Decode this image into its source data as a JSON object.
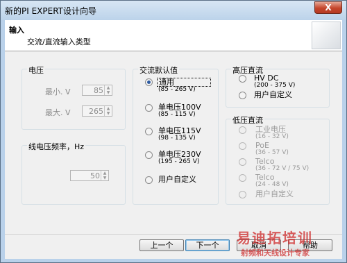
{
  "window": {
    "title": "新的PI EXPERT设计向导",
    "close_glyph": "X"
  },
  "header": {
    "title": "输入",
    "subtitle": "交流/直流输入类型"
  },
  "voltage": {
    "label": "电压",
    "min_label": "最小. V",
    "min_value": "85",
    "max_label": "最大. V",
    "max_value": "265"
  },
  "frequency": {
    "label": "线电压频率，Hz",
    "value": "50"
  },
  "ac_default": {
    "label": "交流默认值",
    "options": [
      {
        "label": "通用",
        "range": "(85 - 265 V)",
        "checked": true
      },
      {
        "label": "单电压100V",
        "range": "(85 - 115 V)",
        "checked": false
      },
      {
        "label": "单电压115V",
        "range": "(98 - 135 V)",
        "checked": false
      },
      {
        "label": "单电压230V",
        "range": "(195 - 265 V)",
        "checked": false
      },
      {
        "label": "用户自定义",
        "range": "",
        "checked": false
      }
    ]
  },
  "hv_dc": {
    "label": "高压直流",
    "options": [
      {
        "label": "HV DC",
        "range": "(200 - 375 V)"
      },
      {
        "label": "用户自定义",
        "range": ""
      }
    ]
  },
  "lv_dc": {
    "label": "低压直流",
    "options": [
      {
        "label": "工业电压",
        "range": "(16 - 32 V)"
      },
      {
        "label": "PoE",
        "range": "(36 - 57 V)"
      },
      {
        "label": "Telco",
        "range": "(36 - 72 V / 75 V)"
      },
      {
        "label": "Telco",
        "range": "(24 - 48 V)"
      },
      {
        "label": "用户自定义",
        "range": ""
      }
    ]
  },
  "buttons": {
    "prev": "上一个",
    "next": "下一个",
    "cancel": "取消",
    "help": "帮助"
  },
  "watermark": {
    "line1": "易迪拓培训",
    "line2": "射频和天线设计专家"
  }
}
